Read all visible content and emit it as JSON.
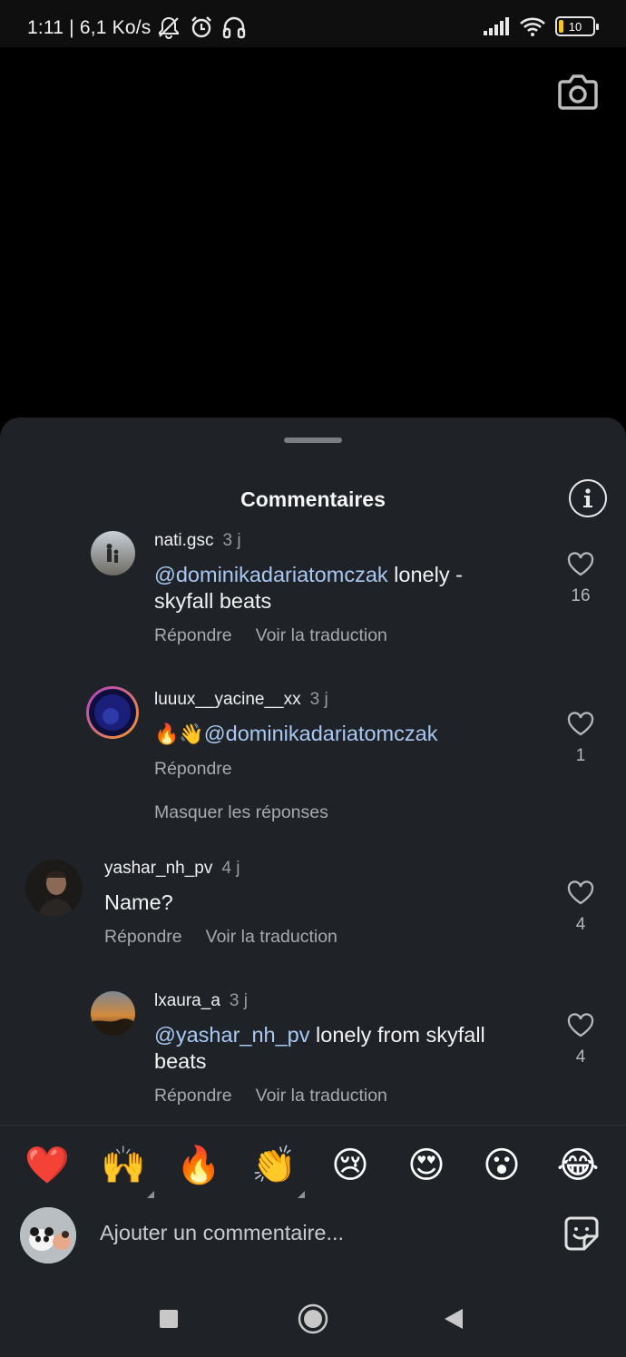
{
  "status_bar": {
    "time": "1:11 | 6,1 Ko/s",
    "battery": "10",
    "icons": [
      "bell-off-icon",
      "alarm-icon",
      "headphones-icon",
      "signal-icon",
      "wifi-icon",
      "battery-icon"
    ]
  },
  "sheet": {
    "title": "Commentaires"
  },
  "comments": [
    {
      "username": "nati.gsc",
      "time": "3 j",
      "mention": "@dominikadariatomczak",
      "text_line1": " lonely -",
      "text_line2": "skyfall beats",
      "reply": "Répondre",
      "translate": "Voir la traduction",
      "likes": "16"
    },
    {
      "username": "luuux__yacine__xx",
      "time": "3 j",
      "emojis": "🔥👋",
      "mention": "@dominikadariatomczak",
      "reply": "Répondre",
      "likes": "1"
    },
    {
      "username": "yashar_nh_pv",
      "time": "4 j",
      "text": "Name?",
      "reply": "Répondre",
      "translate": "Voir la traduction",
      "likes": "4"
    },
    {
      "username": "lxaura_a",
      "time": "3 j",
      "mention": "@yashar_nh_pv",
      "text_line1": " lonely from skyfall",
      "text_line2": "beats",
      "reply": "Répondre",
      "translate": "Voir la traduction",
      "likes": "4"
    }
  ],
  "hide_replies": "Masquer les réponses",
  "reactions": [
    "❤️",
    "🙌",
    "🔥",
    "👏",
    "😢",
    "😍",
    "😮",
    "😂"
  ],
  "composer": {
    "placeholder": "Ajouter un commentaire..."
  },
  "colors": {
    "sheet_bg": "#1f2226",
    "mention": "#a9c9f5",
    "muted": "#a8aaae"
  }
}
